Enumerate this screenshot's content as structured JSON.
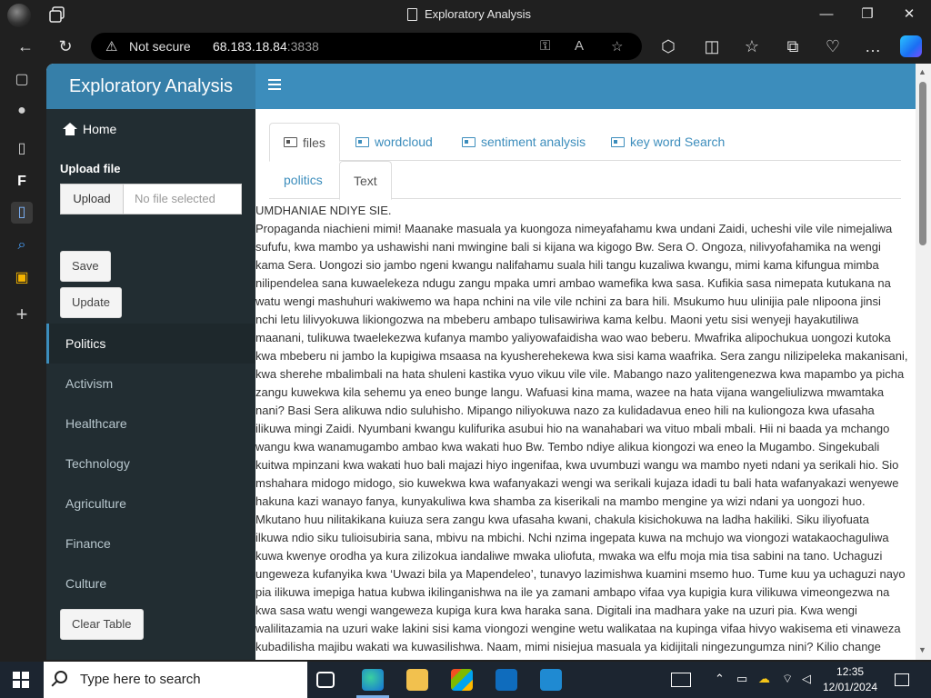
{
  "browser": {
    "tab_title": "Exploratory Analysis",
    "security_label": "Not secure",
    "url_host": "68.183.18.84",
    "url_port": ":3838"
  },
  "app": {
    "title": "Exploratory Analysis",
    "home_label": "Home",
    "upload_label": "Upload file",
    "upload_button": "Upload",
    "file_placeholder": "No file selected",
    "save_button": "Save",
    "update_button": "Update",
    "clear_button": "Clear Table",
    "menu": [
      {
        "label": "Politics",
        "active": true
      },
      {
        "label": "Activism"
      },
      {
        "label": "Healthcare"
      },
      {
        "label": "Technology"
      },
      {
        "label": "Agriculture"
      },
      {
        "label": "Finance"
      },
      {
        "label": "Culture"
      }
    ],
    "tabs": [
      {
        "label": "files",
        "active": true
      },
      {
        "label": "wordcloud"
      },
      {
        "label": "sentiment analysis"
      },
      {
        "label": "key word Search"
      }
    ],
    "subtabs": [
      {
        "label": "politics"
      },
      {
        "label": "Text",
        "active": true
      }
    ]
  },
  "text_output": {
    "heading": "UMDHANIAE NDIYE SIE.",
    "lines": [
      "Propaganda niachieni mimi! Maanake masuala ya kuongoza nimeyafahamu kwa undani Zaidi, ucheshi vile vile nimejaliwa",
      "sufufu, kwa mambo ya ushawishi nani mwingine bali si kijana wa kigogo Bw. Sera O. Ongoza, nilivyofahamika na wengi",
      "kama Sera. Uongozi sio jambo ngeni kwangu nalifahamu suala hili tangu kuzaliwa kwangu, mimi kama kifungua mimba",
      "nilipendelea sana kuwaelekeza ndugu zangu mpaka umri ambao wamefika kwa sasa. Kufikia sasa nimepata kutukana na",
      "watu wengi mashuhuri wakiwemo wa hapa nchini na vile vile nchini za bara hili. Msukumo huu ulinijia pale nlipoona jinsi",
      "nchi letu lilivyokuwa likiongozwa na mbeberu ambapo tulisawiriwa kama kelbu. Maoni yetu sisi wenyeji hayakutiliwa",
      "maanani, tulikuwa twaelekezwa kufanya mambo yaliyowafaidisha wao wao beberu. Mwafrika alipochukua uongozi kutoka",
      "kwa mbeberu ni jambo la kupigiwa msaasa na kyusherehekewa kwa sisi kama waafrika. Sera zangu nilizipeleka makanisani,",
      "kwa sherehe mbalimbali na hata shuleni kastika vyuo vikuu vile vile. Mabango nazo yalitengenezwa kwa mapambo ya picha",
      "zangu kuwekwa kila sehemu ya eneo bunge langu. Wafuasi kina mama, wazee na hata vijana wangeliulizwa mwamtaka",
      "nani? Basi Sera alikuwa ndio suluhisho. Mipango niliyokuwa nazo za kulidadavua eneo hili na kuliongoza kwa ufasaha",
      "ilikuwa mingi Zaidi. Nyumbani kwangu kulifurika asubui hio na wanahabari wa vituo mbali mbali. Hii ni baada ya mchango",
      "wangu kwa wanamugambo ambao kwa wakati huo Bw. Tembo ndiye alikua kiongozi wa eneo la Mugambo. Singekubali",
      "kuitwa mpinzani kwa wakati huo bali majazi hiyo ingenifaa, kwa uvumbuzi wangu wa mambo nyeti ndani ya serikali hio. Sio",
      "mshahara midogo midogo, sio kuwekwa kwa wafanyakazi wengi wa serikali kujaza idadi tu bali hata wafanyakazi wenyewe",
      "hakuna kazi wanayo fanya, kunyakuliwa kwa shamba za kiserikali na mambo mengine ya wizi ndani ya uongozi huo.",
      "Mkutano huu nilitakikana kuiuza sera zangu kwa ufasaha kwani, chakula kisichokuwa na ladha hakiliki. Siku iliyofuata",
      "ilkuwa ndio siku tulioisubiria sana, mbivu na mbichi. Nchi nzima ingepata kuwa na mchujo wa viongozi watakaochaguliwa",
      "kuwa kwenye orodha ya kura zilizokua iandaliwe mwaka uliofuta, mwaka wa elfu moja mia tisa sabini na tano. Uchaguzi",
      "ungeweza kufanyika kwa ‘Uwazi bila ya Mapendeleo’, tunavyo lazimishwa kuamini msemo huo. Tume kuu ya uchaguzi nayo",
      "pia ilikuwa imepiga hatua kubwa ikilinganishwa na ile ya zamani ambapo vifaa vya kupigia kura vilikuwa vimeongezwa na",
      "kwa sasa watu wengi wangeweza kupiga kura kwa haraka sana. Digitali ina madhara yake na uzuri pia. Kwa wengi",
      "walilitazamia na uzuri wake lakini sisi kama viongozi wengine wetu walikataa na kupinga vifaa hivyo wakisema eti vinaweza",
      "kubadilisha majibu wakati wa kuwasilishwa. Naam, mimi nisiejua masuala ya kidijitali ningezungumza nini? Kilio change"
    ]
  },
  "taskbar": {
    "search_placeholder": "Type here to search",
    "time": "12:35",
    "date": "12/01/2024"
  }
}
